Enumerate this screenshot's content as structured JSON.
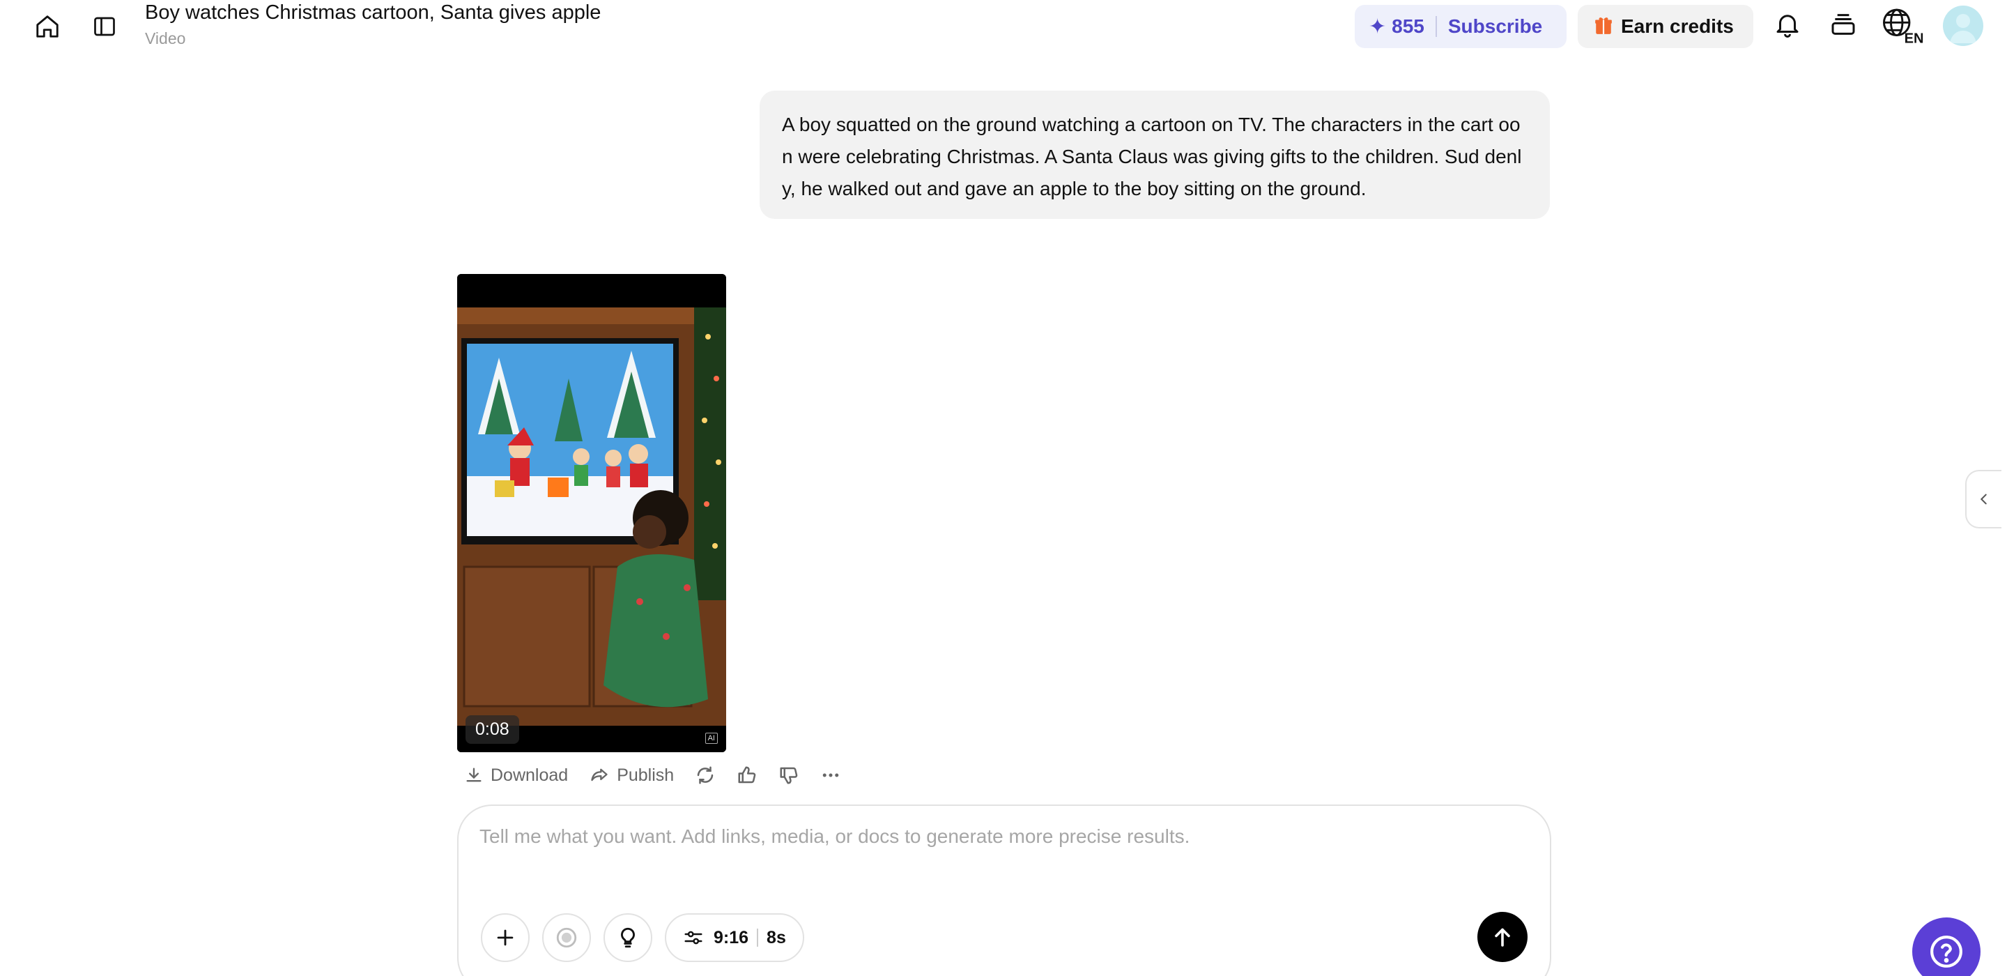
{
  "header": {
    "title": "Boy watches Christmas cartoon, Santa gives apple",
    "subtitle": "Video",
    "credits": "855",
    "subscribe_label": "Subscribe",
    "earn_label": "Earn credits",
    "language": "EN",
    "brand_color": "#4f46c8"
  },
  "message": {
    "text": "A boy squatted on the ground watching a cartoon on TV. The characters in the cart oon were celebrating Christmas. A Santa Claus was giving gifts to the children. Sud denly, he walked out and gave an apple to the boy sitting on the ground."
  },
  "video": {
    "duration": "0:08",
    "ai_badge": "AI"
  },
  "actions": {
    "download_label": "Download",
    "publish_label": "Publish"
  },
  "composer": {
    "placeholder": "Tell me what you want. Add links, media, or docs to generate more precise results.",
    "value": "",
    "aspect_ratio": "9:16",
    "duration": "8s"
  }
}
